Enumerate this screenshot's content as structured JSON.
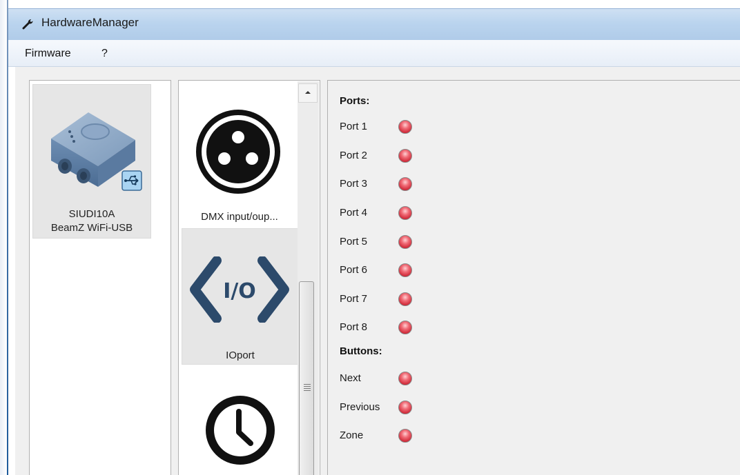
{
  "window": {
    "title": "HardwareManager",
    "icon": "wrench-icon"
  },
  "menubar": {
    "items": [
      "Firmware",
      "?"
    ]
  },
  "devices": [
    {
      "model": "SIUDI10A",
      "name": "BeamZ WiFi-USB",
      "icon": "interface-box-icon",
      "badge_icon": "usb-icon"
    }
  ],
  "features": [
    {
      "label": "DMX input/oup...",
      "icon": "xlr-connector-icon",
      "selected": false
    },
    {
      "label": "IOport",
      "icon": "io-code-icon",
      "icon_text": "I/O",
      "selected": true
    },
    {
      "label": "",
      "icon": "clock-icon",
      "selected": false
    }
  ],
  "ports": {
    "title": "Ports:",
    "items": [
      {
        "label": "Port 1",
        "state": "off"
      },
      {
        "label": "Port 2",
        "state": "off"
      },
      {
        "label": "Port 3",
        "state": "off"
      },
      {
        "label": "Port 4",
        "state": "off"
      },
      {
        "label": "Port 5",
        "state": "off"
      },
      {
        "label": "Port 6",
        "state": "off"
      },
      {
        "label": "Port 7",
        "state": "off"
      },
      {
        "label": "Port 8",
        "state": "off"
      }
    ]
  },
  "buttons": {
    "title": "Buttons:",
    "items": [
      {
        "label": "Next",
        "state": "off"
      },
      {
        "label": "Previous",
        "state": "off"
      },
      {
        "label": "Zone",
        "state": "off"
      }
    ]
  },
  "colors": {
    "led_red": "#e04a57",
    "titlebar": "#bad4ee",
    "io_icon": "#2c4a6b"
  }
}
